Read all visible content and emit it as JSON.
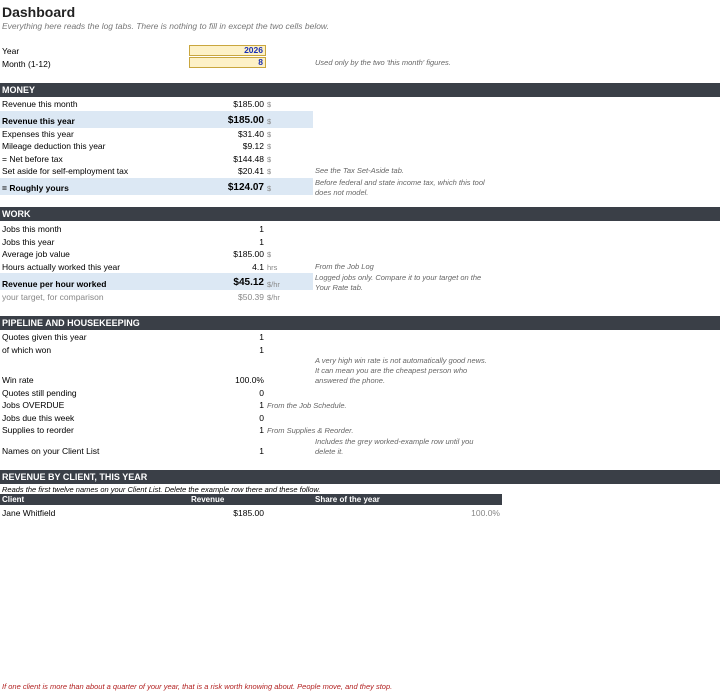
{
  "page": {
    "title": "Dashboard",
    "subtitle": "Everything here reads the log tabs. There is nothing to fill in except the two cells below."
  },
  "inputs": {
    "year_label": "Year",
    "year_value": "2026",
    "month_label": "Month (1-12)",
    "month_value": "8",
    "month_note": "Used only by the two 'this month' figures."
  },
  "money": {
    "header": "MONEY",
    "revenue_month": {
      "label": "Revenue this month",
      "value": "$185.00",
      "unit": "$"
    },
    "revenue_year": {
      "label": "Revenue this year",
      "value": "$185.00",
      "unit": "$"
    },
    "expenses_year": {
      "label": "Expenses this year",
      "value": "$31.40",
      "unit": "$"
    },
    "mileage": {
      "label": "Mileage deduction this year",
      "value": "$9.12",
      "unit": "$"
    },
    "net": {
      "label": "= Net before tax",
      "value": "$144.48",
      "unit": "$"
    },
    "set_aside": {
      "label": "Set aside for self-employment tax",
      "value": "$20.41",
      "unit": "$",
      "note": "See the Tax Set-Aside tab."
    },
    "roughly": {
      "label": "= Roughly yours",
      "value": "$124.07",
      "unit": "$",
      "note1": "Before federal and state income tax, which this tool",
      "note2": "does not model."
    }
  },
  "work": {
    "header": "WORK",
    "jobs_month": {
      "label": "Jobs this month",
      "value": "1"
    },
    "jobs_year": {
      "label": "Jobs this year",
      "value": "1"
    },
    "avg_job": {
      "label": "Average job value",
      "value": "$185.00",
      "unit": "$"
    },
    "hours": {
      "label": "Hours actually worked this year",
      "value": "4.1",
      "unit": "hrs",
      "note": "From the Job Log"
    },
    "rph": {
      "label": "Revenue per hour worked",
      "value": "$45.12",
      "unit": "$/hr",
      "note1": "Logged jobs only. Compare it to your target on the",
      "note2": "Your Rate tab."
    },
    "target": {
      "label": "your target, for comparison",
      "value": "$50.39",
      "unit": "$/hr"
    }
  },
  "pipeline": {
    "header": "PIPELINE AND HOUSEKEEPING",
    "quotes": {
      "label": "Quotes given this year",
      "value": "1"
    },
    "won": {
      "label": "of which won",
      "value": "1"
    },
    "win_note1": "A very high win rate is not automatically good news.",
    "win_note2": "It can mean you are the cheapest person who",
    "win_note3": "answered the phone.",
    "win_rate": {
      "label": "Win rate",
      "value": "100.0%"
    },
    "pending": {
      "label": "Quotes still pending",
      "value": "0"
    },
    "overdue": {
      "label": "Jobs OVERDUE",
      "value": "1",
      "note": "From the Job Schedule."
    },
    "due_week": {
      "label": "Jobs due this week",
      "value": "0"
    },
    "supplies": {
      "label": "Supplies to reorder",
      "value": "1",
      "note": "From Supplies & Reorder."
    },
    "client_note1": "Includes the grey worked-example row until you",
    "client_note2": "delete it.",
    "clients": {
      "label": "Names on your Client List",
      "value": "1"
    }
  },
  "revenue_by_client": {
    "header": "REVENUE BY CLIENT, THIS YEAR",
    "subtitle": "Reads the first twelve names on your Client List. Delete the example row there and these follow.",
    "columns": [
      "Client",
      "Revenue",
      "Share of the year"
    ],
    "rows": [
      {
        "client": "Jane Whitfield",
        "revenue": "$185.00",
        "share": "100.0%"
      }
    ]
  },
  "footer": "If one client is more than about a quarter of your year, that is a risk worth knowing about. People move, and they stop."
}
